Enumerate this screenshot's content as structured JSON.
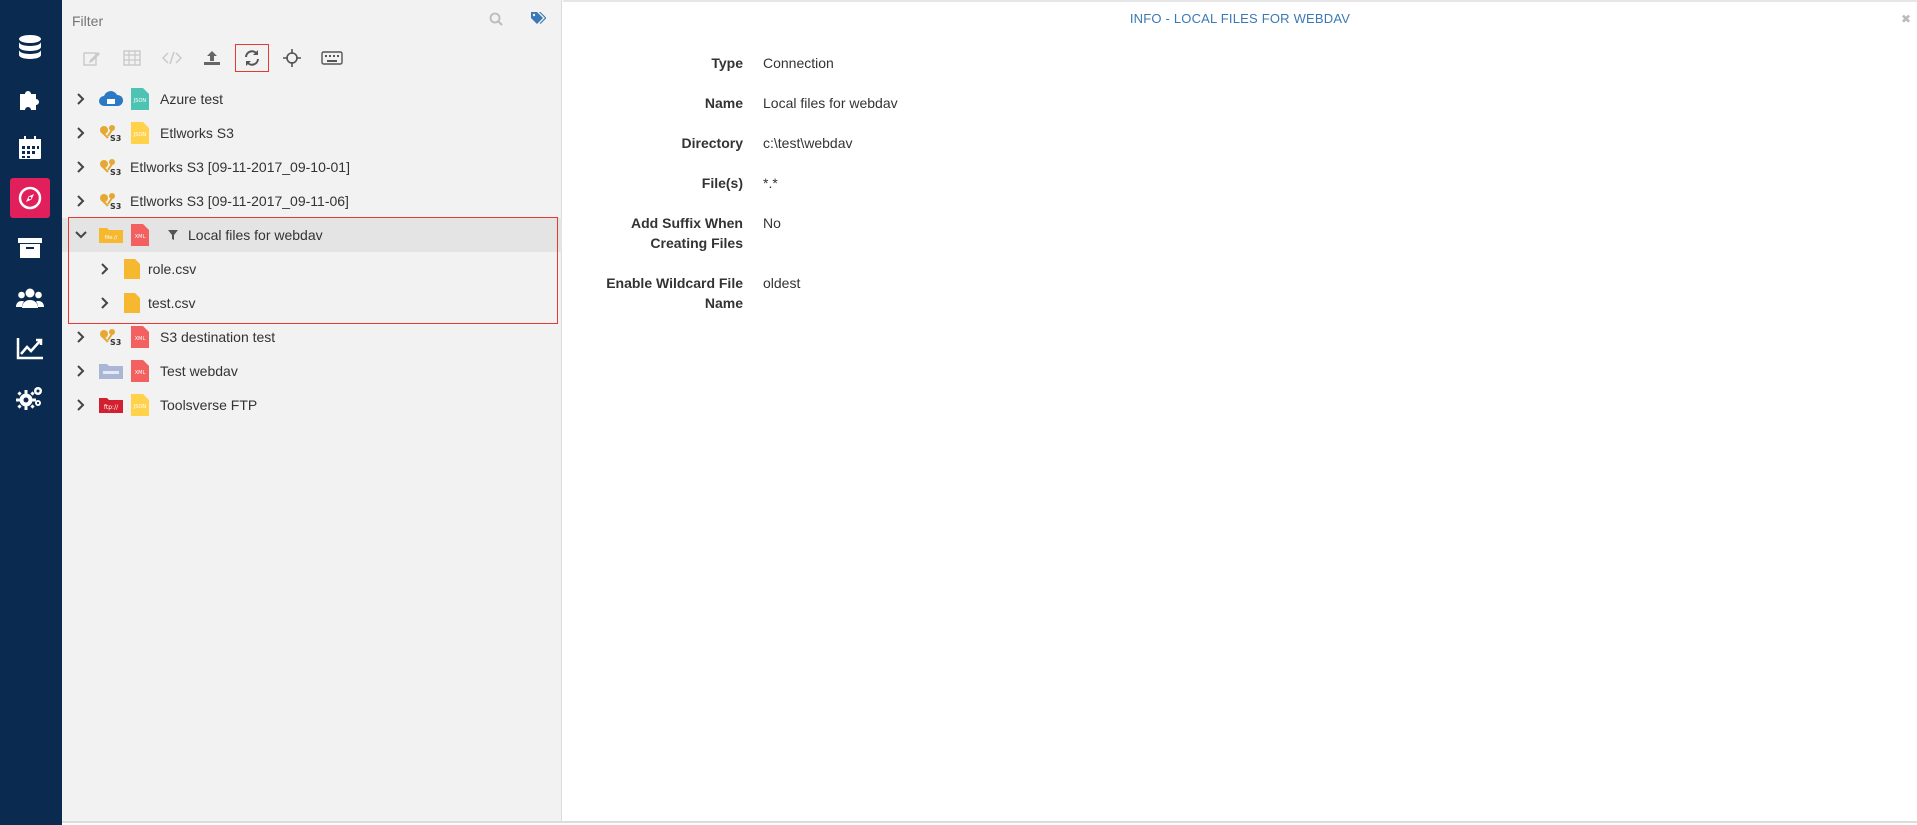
{
  "nav": {
    "items": [
      {
        "icon": "database-icon"
      },
      {
        "icon": "puzzle-icon"
      },
      {
        "icon": "calendar-icon"
      },
      {
        "icon": "compass-icon",
        "active": true
      },
      {
        "icon": "archive-icon"
      },
      {
        "icon": "users-icon"
      },
      {
        "icon": "chart-icon"
      },
      {
        "icon": "gears-icon"
      }
    ],
    "accent_color": "#e01f5b",
    "background_color": "#0a2a4f"
  },
  "explorer": {
    "filter_placeholder": "Filter",
    "toolbar": [
      {
        "icon": "edit-icon",
        "enabled": false
      },
      {
        "icon": "table-icon",
        "enabled": false
      },
      {
        "icon": "code-icon",
        "enabled": false
      },
      {
        "icon": "upload-icon",
        "enabled": true
      },
      {
        "icon": "refresh-icon",
        "enabled": true,
        "highlighted": true
      },
      {
        "icon": "crosshair-icon",
        "enabled": true
      },
      {
        "icon": "keyboard-icon",
        "enabled": true
      }
    ],
    "tree": [
      {
        "label": "Azure test",
        "conn_icon": "azure-icon",
        "file_icon": "json-file-icon",
        "expanded": false
      },
      {
        "label": "Etlworks S3",
        "conn_icon": "s3-icon",
        "file_icon": "json-file-icon",
        "expanded": false
      },
      {
        "label": "Etlworks S3 [09-11-2017_09-10-01]",
        "conn_icon": "s3-icon",
        "file_icon": "",
        "expanded": false
      },
      {
        "label": "Etlworks S3 [09-11-2017_09-11-06]",
        "conn_icon": "s3-icon",
        "file_icon": "",
        "expanded": false
      },
      {
        "label": "Local files for webdav",
        "conn_icon": "local-folder-icon",
        "file_icon": "xml-file-icon",
        "expanded": true,
        "selected": true,
        "filtered": true,
        "children": [
          {
            "label": "role.csv"
          },
          {
            "label": "test.csv"
          }
        ]
      },
      {
        "label": "S3 destination test",
        "conn_icon": "s3-icon",
        "file_icon": "xml-file-icon",
        "expanded": false
      },
      {
        "label": "Test webdav",
        "conn_icon": "webdav-icon",
        "file_icon": "xml-file-icon",
        "expanded": false
      },
      {
        "label": "Toolsverse FTP",
        "conn_icon": "ftp-icon",
        "file_icon": "json-file-icon",
        "expanded": false
      }
    ]
  },
  "info": {
    "title": "INFO - LOCAL FILES FOR WEBDAV",
    "properties": [
      {
        "label": "Type",
        "value": "Connection"
      },
      {
        "label": "Name",
        "value": "Local files for webdav"
      },
      {
        "label": "Directory",
        "value": "c:\\test\\webdav"
      },
      {
        "label": "File(s)",
        "value": "*.*"
      },
      {
        "label_line1": "Add Suffix When",
        "label_line2": "Creating Files",
        "value": "No"
      },
      {
        "label_line1": "Enable Wildcard File",
        "label_line2": "Name",
        "value": "oldest"
      }
    ],
    "title_color": "#3a79b5"
  }
}
